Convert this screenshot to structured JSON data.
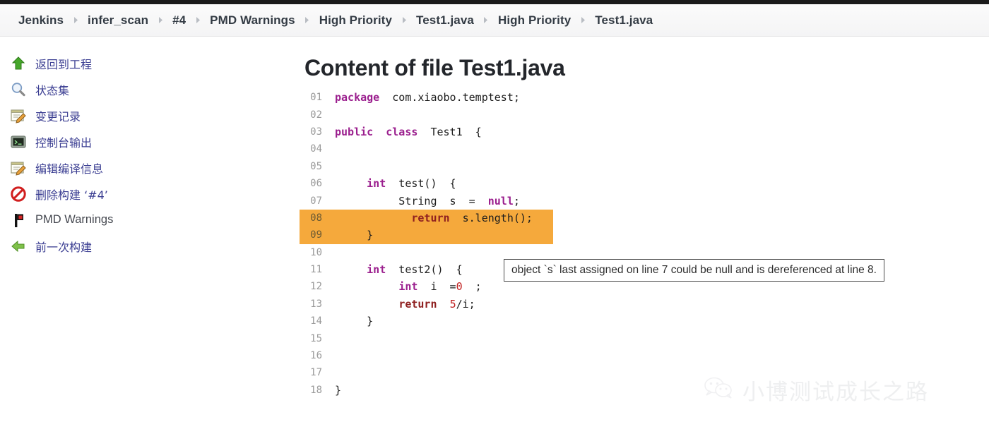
{
  "breadcrumb": {
    "separator_icon": "chevron-right-icon",
    "items": [
      {
        "label": "Jenkins"
      },
      {
        "label": "infer_scan"
      },
      {
        "label": "#4"
      },
      {
        "label": "PMD Warnings"
      },
      {
        "label": "High Priority"
      },
      {
        "label": "Test1.java"
      },
      {
        "label": "High Priority"
      },
      {
        "label": "Test1.java"
      }
    ]
  },
  "sidebar": {
    "items": [
      {
        "label": "返回到工程",
        "icon": "up-arrow-icon",
        "latin": false
      },
      {
        "label": "状态集",
        "icon": "magnifier-icon",
        "latin": false
      },
      {
        "label": "变更记录",
        "icon": "notepad-pencil-icon",
        "latin": false
      },
      {
        "label": "控制台输出",
        "icon": "terminal-icon",
        "latin": false
      },
      {
        "label": "编辑编译信息",
        "icon": "notepad-pencil-icon",
        "latin": false
      },
      {
        "label": "删除构建 ‘#4’",
        "icon": "no-entry-icon",
        "latin": false
      },
      {
        "label": "PMD Warnings",
        "icon": "pmd-flag-icon",
        "latin": true
      },
      {
        "label": "前一次构建",
        "icon": "left-arrow-icon",
        "latin": false
      }
    ]
  },
  "main": {
    "title": "Content of file Test1.java",
    "tooltip": "object `s` last assigned on line 7 could be null and is dereferenced at line 8.",
    "highlight_color": "#f5a93c",
    "code": [
      {
        "no": "01",
        "tokens": [
          {
            "t": "package",
            "c": "kw"
          },
          {
            "t": "  com.xiaobo.temptest;",
            "c": ""
          }
        ],
        "hl": false
      },
      {
        "no": "02",
        "tokens": [],
        "hl": false
      },
      {
        "no": "03",
        "tokens": [
          {
            "t": "public",
            "c": "kw"
          },
          {
            "t": "  ",
            "c": ""
          },
          {
            "t": "class",
            "c": "kw"
          },
          {
            "t": "  Test1  {",
            "c": ""
          }
        ],
        "hl": false
      },
      {
        "no": "04",
        "tokens": [],
        "hl": false
      },
      {
        "no": "05",
        "tokens": [],
        "hl": false
      },
      {
        "no": "06",
        "tokens": [
          {
            "t": "     ",
            "c": ""
          },
          {
            "t": "int",
            "c": "kw"
          },
          {
            "t": "  test()  {",
            "c": ""
          }
        ],
        "hl": false
      },
      {
        "no": "07",
        "tokens": [
          {
            "t": "          String  s  =  ",
            "c": ""
          },
          {
            "t": "null",
            "c": "kw"
          },
          {
            "t": ";",
            "c": ""
          }
        ],
        "hl": false
      },
      {
        "no": "08",
        "tokens": [
          {
            "t": "            ",
            "c": ""
          },
          {
            "t": "return",
            "c": "kw2"
          },
          {
            "t": "  s.length();",
            "c": ""
          }
        ],
        "hl": true
      },
      {
        "no": "09",
        "tokens": [
          {
            "t": "     }",
            "c": ""
          }
        ],
        "hl": true
      },
      {
        "no": "10",
        "tokens": [],
        "hl": false
      },
      {
        "no": "11",
        "tokens": [
          {
            "t": "     ",
            "c": ""
          },
          {
            "t": "int",
            "c": "kw"
          },
          {
            "t": "  test2()  {",
            "c": ""
          }
        ],
        "hl": false
      },
      {
        "no": "12",
        "tokens": [
          {
            "t": "          ",
            "c": ""
          },
          {
            "t": "int",
            "c": "kw"
          },
          {
            "t": "  i  =",
            "c": ""
          },
          {
            "t": "0",
            "c": "num"
          },
          {
            "t": "  ;",
            "c": ""
          }
        ],
        "hl": false
      },
      {
        "no": "13",
        "tokens": [
          {
            "t": "          ",
            "c": ""
          },
          {
            "t": "return",
            "c": "kw2"
          },
          {
            "t": "  ",
            "c": ""
          },
          {
            "t": "5",
            "c": "num"
          },
          {
            "t": "/i;",
            "c": ""
          }
        ],
        "hl": false
      },
      {
        "no": "14",
        "tokens": [
          {
            "t": "     }",
            "c": ""
          }
        ],
        "hl": false
      },
      {
        "no": "15",
        "tokens": [],
        "hl": false
      },
      {
        "no": "16",
        "tokens": [],
        "hl": false
      },
      {
        "no": "17",
        "tokens": [],
        "hl": false
      },
      {
        "no": "18",
        "tokens": [
          {
            "t": "}",
            "c": ""
          }
        ],
        "hl": false
      }
    ]
  },
  "watermark": {
    "text": "小博测试成长之路",
    "icon": "wechat-icon"
  }
}
